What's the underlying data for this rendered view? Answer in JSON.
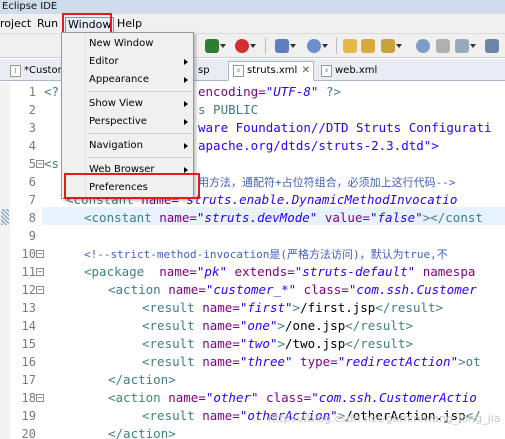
{
  "titlebar": {
    "title": "Eclipse IDE"
  },
  "menubar": {
    "items": [
      "roject",
      "Run",
      "Window",
      "Help"
    ]
  },
  "tabs": [
    {
      "label": "*Custom"
    },
    {
      "label": "sp"
    },
    {
      "label": "struts.xml",
      "active": true
    },
    {
      "label": "web.xml"
    }
  ],
  "window_menu": {
    "items": [
      "New Window",
      "Editor",
      "Appearance",
      "Show View",
      "Perspective",
      "Navigation",
      "Web Browser",
      "Preferences"
    ]
  },
  "line_numbers": [
    "1",
    "2",
    "3",
    "4",
    "5",
    "6",
    "7",
    "8",
    "9",
    "10",
    "11",
    "12",
    "13",
    "14",
    "15",
    "16",
    "17",
    "18",
    "19",
    "20"
  ],
  "code": {
    "l1": {
      "a": "<?",
      "b": "encoding=",
      "c": "\"UTF-8\"",
      "d": " ?>"
    },
    "l2": {
      "a": "s PUBLIC"
    },
    "l3": {
      "a": "ware Foundation//DTD Struts Configurati"
    },
    "l4": {
      "a": "apache.org/dtds/struts-2.3.dtd\">"
    },
    "l5": {
      "a": "<s"
    },
    "l6": {
      "a": "用方法，通配符+占位符组合，必须加上这行代码-->"
    },
    "l7": {
      "a": "<constant",
      "b": " name=",
      "c": "\"struts.enable.DynamicMethodInvocatio"
    },
    "l8": {
      "a": "<constant",
      "b": " name=",
      "c": "\"struts.devMode\"",
      "d": " value=",
      "e": "\"false\"",
      "f": "></const"
    },
    "l10": {
      "a": "<!--strict-method-invocation是(严格方法访问)，默认为true,不"
    },
    "l11": {
      "a": "<package",
      "b": "  name=",
      "c": "\"pk\"",
      "d": " extends=",
      "e": "\"struts-default\"",
      "f": " namespa"
    },
    "l12": {
      "a": "<action",
      "b": " name=",
      "c": "\"customer_*\"",
      "d": " class=",
      "e": "\"com.ssh.Customer"
    },
    "l13": {
      "a": "<result",
      "b": " name=",
      "c": "\"first\"",
      "d": ">",
      "e": "/first.jsp",
      "f": "</result>"
    },
    "l14": {
      "a": "<result",
      "b": " name=",
      "c": "\"one\"",
      "d": ">",
      "e": "/one.jsp",
      "f": "</result>"
    },
    "l15": {
      "a": "<result",
      "b": " name=",
      "c": "\"two\"",
      "d": ">",
      "e": "/two.jsp",
      "f": "</result>"
    },
    "l16": {
      "a": "<result",
      "b": " name=",
      "c": "\"three\"",
      "d": " type=",
      "e": "\"redirectAction\"",
      "f": ">ot"
    },
    "l17": {
      "a": "</action>"
    },
    "l18": {
      "a": "<action",
      "b": " name=",
      "c": "\"other\"",
      "d": " class=",
      "e": "\"com.ssh.CustomerActio"
    },
    "l19": {
      "a": "<result",
      "b": " name=",
      "c": "\"otherAction\"",
      "d": ">",
      "e": "/otherAction.jsp",
      "f": "</"
    },
    "l20": {
      "a": "</action>"
    }
  },
  "watermark": "https://blog.csdn.net/geminiwang_long_jia"
}
